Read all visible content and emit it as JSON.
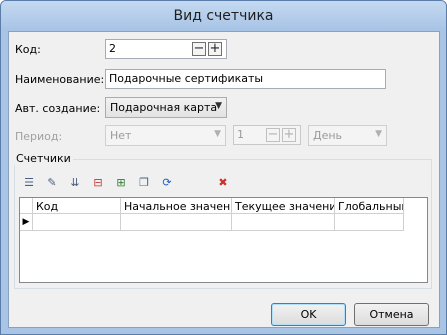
{
  "window": {
    "title": "Вид счетчика"
  },
  "form": {
    "code": {
      "label": "Код:",
      "value": "2"
    },
    "name": {
      "label": "Наименование:",
      "value": "Подарочные сертификаты"
    },
    "auto_create": {
      "label": "Авт. создание:",
      "value": "Подарочная карта"
    },
    "period": {
      "label": "Период:",
      "type_value": "Нет",
      "count_value": "1",
      "unit_value": "День"
    }
  },
  "counters": {
    "group_label": "Счетчики",
    "toolbar": [
      {
        "name": "delete-all-rows-icon",
        "glyph": "☰",
        "color": "#4a5f84"
      },
      {
        "name": "edit-row-icon",
        "glyph": "✎",
        "color": "#4a5f84"
      },
      {
        "name": "move-down-icon",
        "glyph": "⇊",
        "color": "#4a5f84"
      },
      {
        "name": "delete-row-icon",
        "glyph": "⊟",
        "color": "#c83232"
      },
      {
        "name": "add-row-icon",
        "glyph": "⊞",
        "color": "#2f7f2f"
      },
      {
        "name": "copy-row-icon",
        "glyph": "❐",
        "color": "#4a5f84"
      },
      {
        "name": "refresh-icon",
        "glyph": "⟳",
        "color": "#1d5fc0"
      },
      {
        "name": "clear-icon",
        "glyph": "✖",
        "color": "#c83232"
      }
    ],
    "columns": [
      "Код",
      "Начальное значение",
      "Текущее значение",
      "Глобальный"
    ],
    "row_marker": "▶"
  },
  "buttons": {
    "ok": "OK",
    "cancel": "Отмена"
  },
  "glyphs": {
    "minus": "−",
    "plus": "+",
    "dropdown": "▼"
  }
}
